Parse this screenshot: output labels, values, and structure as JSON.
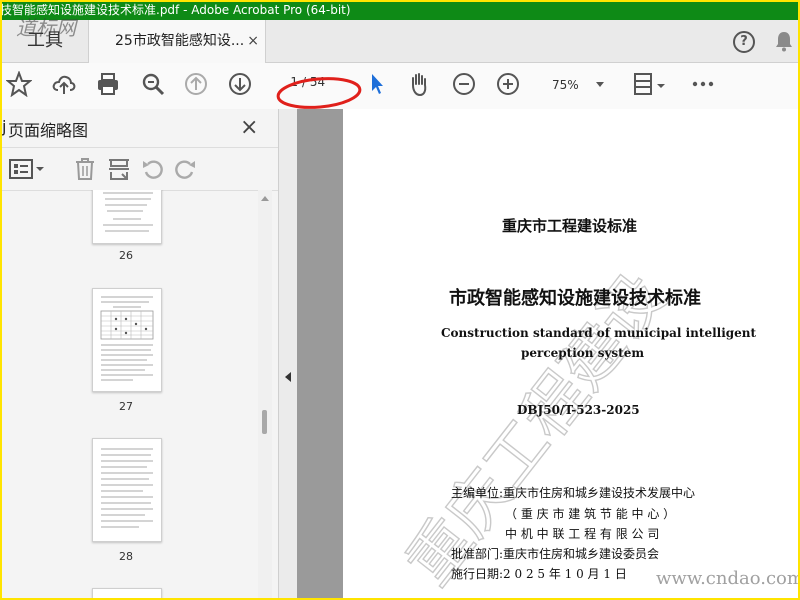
{
  "window": {
    "title": "技智能感知设施建设技术标准.pdf - Adobe Acrobat Pro (64-bit)"
  },
  "tabs": {
    "tools_label": "工具",
    "document_label": "25市政智能感知设...",
    "document_close": "×"
  },
  "toolbar": {
    "page_current": "1",
    "page_total": "/ 54",
    "zoom_value": "75%"
  },
  "sidebar": {
    "title": "页面缩略图",
    "close": "×",
    "thumbnails": [
      {
        "label": "26"
      },
      {
        "label": "27"
      },
      {
        "label": "28"
      }
    ]
  },
  "document": {
    "header": "重庆市工程建设标准",
    "title_cn": "市政智能感知设施建设技术标准",
    "title_en_line1": "Construction standard of municipal intelligent",
    "title_en_line2": "perception system",
    "code": "DBJ50/T-523-2025",
    "editor_line1": "主编单位:重庆市住房和城乡建设技术发展中心",
    "editor_line2": "（ 重 庆 市 建 筑 节 能 中 心 ）",
    "editor_line3": "中 机 中 联 工 程 有 限 公 司",
    "approval_line": "批准部门:重庆市住房和城乡建设委员会",
    "date_line": "施行日期:2  0  2  5    年    1  0    月    1    日",
    "watermark_text": "重庆工程建设"
  },
  "watermarks": {
    "site": "www.cndao.com",
    "logo": "道标网"
  },
  "colors": {
    "title_bar": "#0E8A16",
    "frame_border": "#FFE400",
    "annotation_ellipse": "#E0201B",
    "select_tool": "#1E6FD9"
  },
  "icons": [
    "star-icon",
    "cloud-upload-icon",
    "print-icon",
    "zoom-search-icon",
    "page-up-icon",
    "page-down-icon",
    "select-arrow-icon",
    "hand-icon",
    "zoom-out-icon",
    "zoom-in-icon",
    "fit-page-icon",
    "more-icon",
    "help-icon",
    "bell-icon",
    "thumbnail-options-icon",
    "delete-icon",
    "insert-page-icon",
    "rotate-left-icon",
    "rotate-right-icon"
  ]
}
